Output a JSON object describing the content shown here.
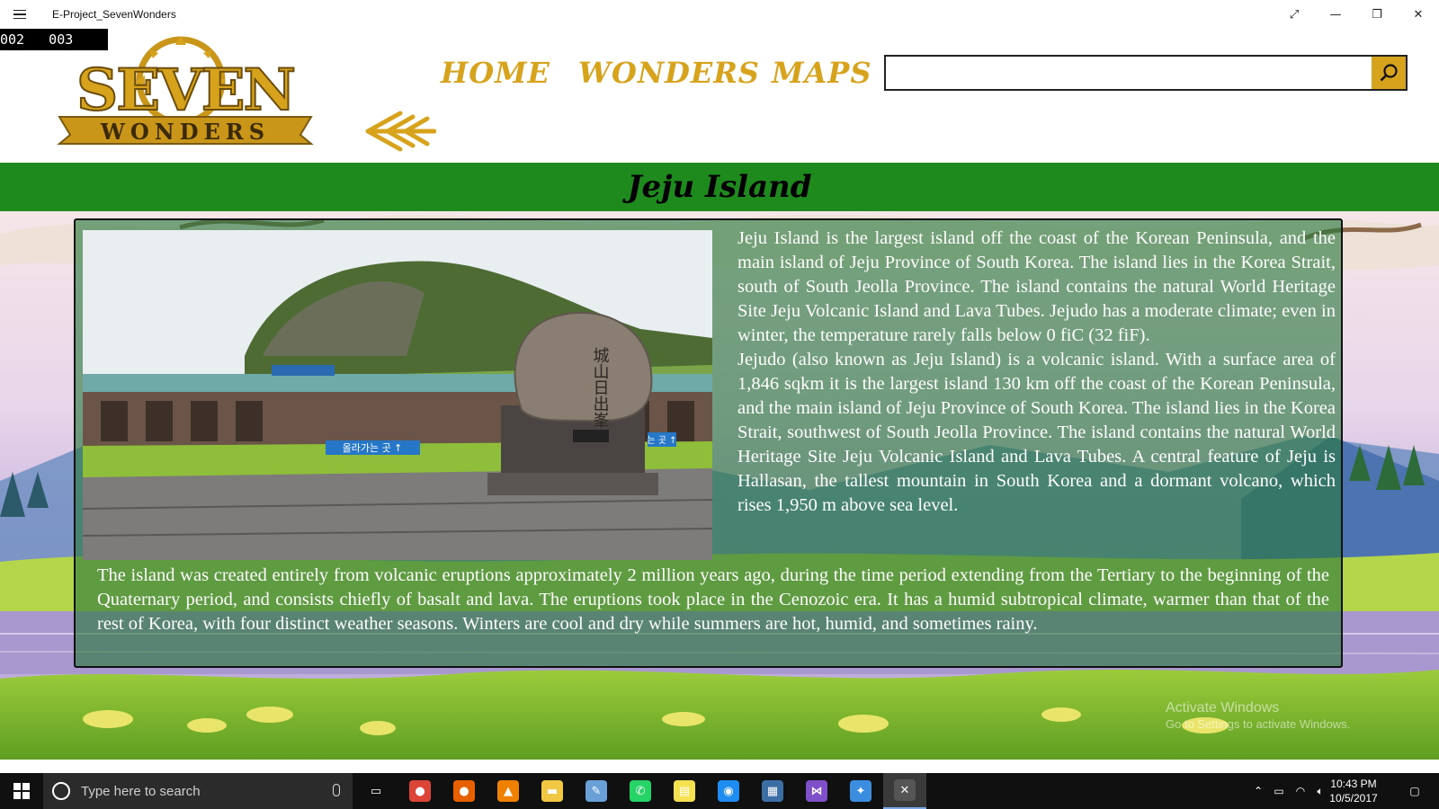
{
  "window": {
    "title": "E-Project_SevenWonders",
    "controls": {
      "fullscreen": "⤢",
      "minimize": "—",
      "restore": "❐",
      "close": "✕"
    }
  },
  "debug_counter": "002   003",
  "logo": {
    "top_text": "SEVEN",
    "bottom_text": "WONDERS"
  },
  "nav": {
    "home": "HOME",
    "wonders": "WONDERS",
    "maps": "MAPS"
  },
  "search": {
    "value": "",
    "placeholder": ""
  },
  "page": {
    "title": "Jeju Island",
    "paragraph1": "Jeju Island is the largest island off the coast of the Korean Peninsula, and the main island of Jeju Province of South Korea. The island lies in the Korea Strait, south of South Jeolla Province. The island contains the natural World Heritage Site Jeju Volcanic Island and Lava Tubes. Jejudo has a moderate climate; even in winter, the temperature rarely falls below 0 fiC (32 fiF).",
    "paragraph2": "Jejudo (also known as Jeju Island) is a volcanic island. With a surface area of 1,846 sqkm it is the largest island 130 km off the coast of the Korean Peninsula, and the main island of Jeju Province of South Korea. The island lies in the Korea Strait, southwest of South Jeolla Province. The island contains the natural World Heritage Site Jeju Volcanic Island and Lava Tubes. A central feature of Jeju is Hallasan, the tallest mountain in South Korea and a dormant volcano, which rises 1,950 m above sea level.",
    "paragraph3": "The island was created entirely from volcanic eruptions approximately 2 million years ago, during the time period extending from the Tertiary to the beginning of the Quaternary period, and consists chiefly of basalt and lava. The eruptions took place in the Cenozoic era. It has a humid subtropical climate, warmer than that of the rest of Korea, with four distinct weather seasons. Winters are cool and dry while summers are hot, humid, and sometimes rainy."
  },
  "photo": {
    "stone_text": "城山日出峯",
    "sign_left": "올라가는 곳 ↑",
    "sign_right": "는 곳 ↑"
  },
  "watermark": {
    "line1": "Activate Windows",
    "line2": "Go to Settings to activate Windows."
  },
  "taskbar": {
    "search_placeholder": "Type here to search",
    "time": "10:43 PM",
    "date": "10/5/2017",
    "apps": [
      {
        "name": "task-view",
        "color": "#101010",
        "glyph": "▭"
      },
      {
        "name": "chrome",
        "color": "#db4437",
        "glyph": "●"
      },
      {
        "name": "firefox",
        "color": "#e66000",
        "glyph": "●"
      },
      {
        "name": "vlc",
        "color": "#f08000",
        "glyph": "▲"
      },
      {
        "name": "file-explorer",
        "color": "#f2c744",
        "glyph": "▬"
      },
      {
        "name": "paint",
        "color": "#6aa0d8",
        "glyph": "✎"
      },
      {
        "name": "whatsapp",
        "color": "#25d366",
        "glyph": "✆"
      },
      {
        "name": "sticky-notes",
        "color": "#f5e050",
        "glyph": "▤"
      },
      {
        "name": "messenger",
        "color": "#1e8cf0",
        "glyph": "◉"
      },
      {
        "name": "app-window",
        "color": "#3a6ea5",
        "glyph": "▦"
      },
      {
        "name": "visual-studio",
        "color": "#7e4fc9",
        "glyph": "⋈"
      },
      {
        "name": "paint-3d",
        "color": "#3b8de0",
        "glyph": "✦"
      },
      {
        "name": "running-app",
        "color": "#555555",
        "glyph": "✕"
      }
    ]
  },
  "colors": {
    "gold": "#d7a21c",
    "band_green": "#1e8a1e",
    "panel_green": "rgba(40,120,60,0.62)"
  }
}
